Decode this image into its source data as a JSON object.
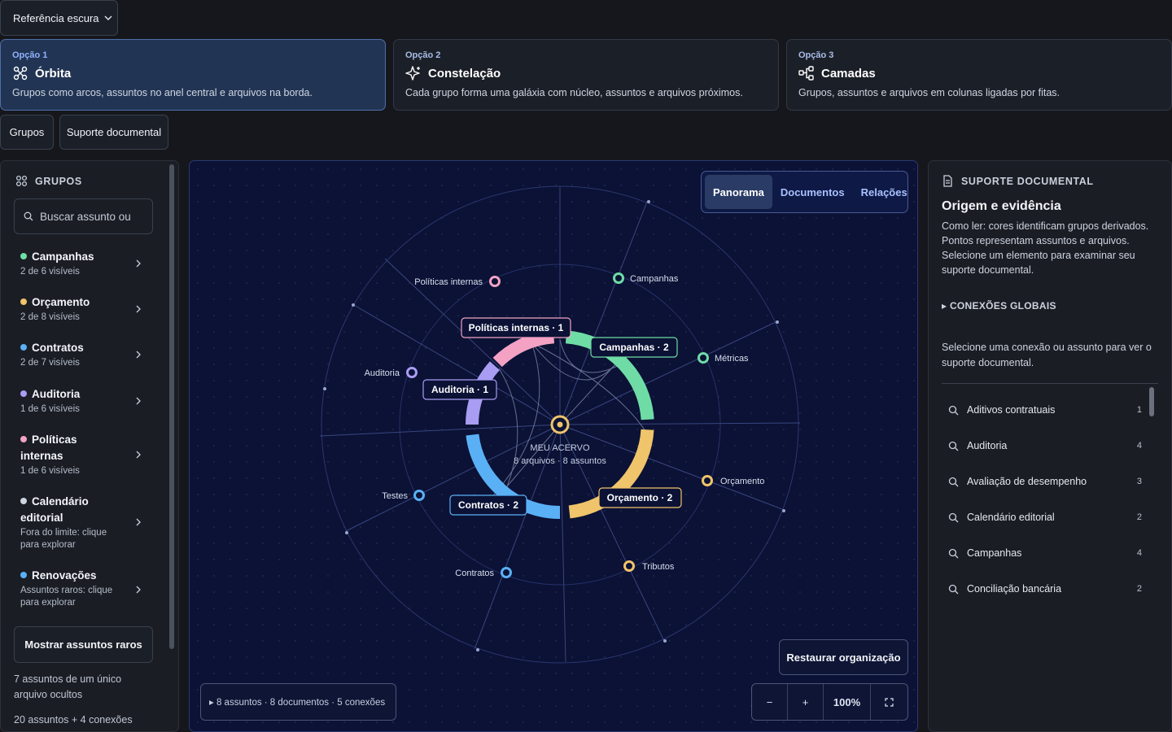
{
  "reference_select": {
    "label": "Referência escura"
  },
  "options": [
    {
      "label": "Opção 1",
      "title": "Órbita",
      "desc": "Grupos como arcos, assuntos no anel central e arquivos na borda.",
      "icon": "orbit-icon"
    },
    {
      "label": "Opção 2",
      "title": "Constelação",
      "desc": "Cada grupo forma uma galáxia com núcleo, assuntos e arquivos próximos.",
      "icon": "sparkle-icon"
    },
    {
      "label": "Opção 3",
      "title": "Camadas",
      "desc": "Grupos, assuntos e arquivos em colunas ligadas por fitas.",
      "icon": "layers-icon"
    }
  ],
  "toggles": {
    "grupos": "Grupos",
    "suporte": "Suporte documental"
  },
  "left_panel": {
    "heading": "GRUPOS",
    "search_placeholder": "Buscar assunto ou",
    "groups": [
      {
        "name": "Campanhas",
        "sub": "2 de 6 visíveis",
        "color": "#6fdca6"
      },
      {
        "name": "Orçamento",
        "sub": "2 de 8 visíveis",
        "color": "#f0c46a"
      },
      {
        "name": "Contratos",
        "sub": "2 de 7 visíveis",
        "color": "#5ab0f5"
      },
      {
        "name": "Auditoria",
        "sub": "1 de 6 visíveis",
        "color": "#a99cf3"
      },
      {
        "name": "Políticas internas",
        "sub": "1 de 6 visíveis",
        "color": "#f3a2c4"
      },
      {
        "name": "Calendário editorial",
        "sub": "Fora do limite: clique para explorar",
        "color": "#cfd5df"
      },
      {
        "name": "Renovações",
        "sub": "Assuntos raros: clique para explorar",
        "color": "#5ab0f5"
      }
    ],
    "show_rare_button": "Mostrar assuntos raros",
    "hidden_note": "7 assuntos de um único arquivo ocultos",
    "totals_note": "20 assuntos + 4 conexões"
  },
  "canvas": {
    "tabs": [
      "Panorama",
      "Documentos",
      "Relações"
    ],
    "active_tab": "Panorama",
    "center_title": "MEU ACERVO",
    "center_sub": "8 arquivos · 8 assuntos",
    "arc_labels": [
      {
        "text": "Políticas internas · 1",
        "color": "#f3a2c4"
      },
      {
        "text": "Campanhas · 2",
        "color": "#6fdca6"
      },
      {
        "text": "Auditoria · 1",
        "color": "#a99cf3"
      },
      {
        "text": "Orçamento · 2",
        "color": "#f0c46a"
      },
      {
        "text": "Contratos · 2",
        "color": "#5ab0f5"
      }
    ],
    "nodes": [
      {
        "text": "Políticas internas",
        "color": "#f3a2c4"
      },
      {
        "text": "Campanhas",
        "color": "#6fdca6"
      },
      {
        "text": "Métricas",
        "color": "#6fdca6"
      },
      {
        "text": "Auditoria",
        "color": "#a99cf3"
      },
      {
        "text": "Orçamento",
        "color": "#f0c46a"
      },
      {
        "text": "Testes",
        "color": "#5ab0f5"
      },
      {
        "text": "Tributos",
        "color": "#f0c46a"
      },
      {
        "text": "Contratos",
        "color": "#5ab0f5"
      }
    ],
    "restore_button": "Restaurar organização",
    "summary": "▸ 8 assuntos · 8 documentos · 5 conexões",
    "zoom": {
      "minus": "−",
      "plus": "+",
      "level": "100%"
    }
  },
  "right_panel": {
    "heading": "SUPORTE DOCUMENTAL",
    "title": "Origem e evidência",
    "desc": "Como ler: cores identificam grupos derivados. Pontos representam assuntos e arquivos. Selecione um elemento para examinar seu suporte documental.",
    "global_connections": "▸ CONEXÕES GLOBAIS",
    "select_note": "Selecione uma conexão ou assunto para ver o suporte documental.",
    "subjects": [
      {
        "name": "Aditivos contratuais",
        "count": "1"
      },
      {
        "name": "Auditoria",
        "count": "4"
      },
      {
        "name": "Avaliação de desempenho",
        "count": "3"
      },
      {
        "name": "Calendário editorial",
        "count": "2"
      },
      {
        "name": "Campanhas",
        "count": "4"
      },
      {
        "name": "Conciliação bancária",
        "count": "2"
      }
    ]
  }
}
